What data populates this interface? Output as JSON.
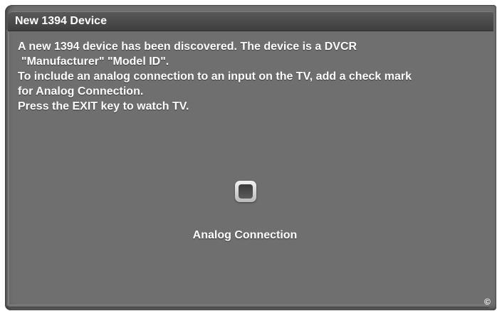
{
  "dialog": {
    "title": "New 1394 Device",
    "message_lines": [
      "A new 1394 device has been discovered. The device is a  DVCR",
      " \"Manufacturer\" \"Model ID\".",
      "To include an analog connection to an input on the TV, add a check mark",
      "for Analog Connection.",
      "Press the EXIT key to watch TV."
    ],
    "checkbox": {
      "label": "Analog Connection",
      "checked": false
    },
    "copyright_symbol": "©"
  },
  "colors": {
    "panel_background": "#6f6f6f",
    "title_bar": "#4a4a4a",
    "text": "#ffffff"
  }
}
